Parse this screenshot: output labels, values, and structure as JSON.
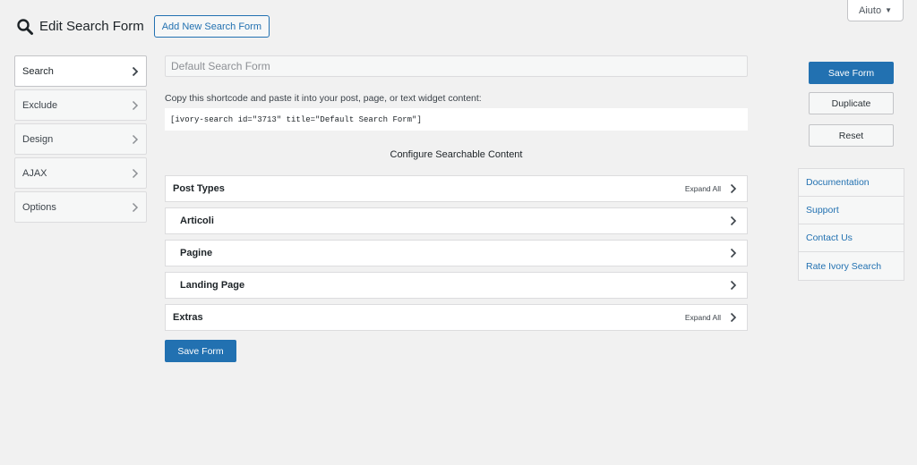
{
  "help": {
    "label": "Aiuto"
  },
  "header": {
    "title": "Edit Search Form",
    "add_new_label": "Add New Search Form"
  },
  "side_tabs": [
    {
      "label": "Search",
      "active": true
    },
    {
      "label": "Exclude"
    },
    {
      "label": "Design"
    },
    {
      "label": "AJAX"
    },
    {
      "label": "Options"
    }
  ],
  "form": {
    "title_placeholder": "Default Search Form",
    "shortcode_desc": "Copy this shortcode and paste it into your post, page, or text widget content:",
    "shortcode": "[ivory-search id=\"3713\" title=\"Default Search Form\"]",
    "config_heading": "Configure Searchable Content",
    "panels": [
      {
        "label": "Post Types",
        "expand_all": "Expand All"
      },
      {
        "label": "Articoli"
      },
      {
        "label": "Pagine"
      },
      {
        "label": "Landing Page"
      },
      {
        "label": "Extras",
        "expand_all": "Expand All"
      }
    ],
    "save_label": "Save Form"
  },
  "actions": {
    "save_label": "Save Form",
    "duplicate_label": "Duplicate",
    "reset_label": "Reset"
  },
  "links": [
    {
      "label": "Documentation"
    },
    {
      "label": "Support"
    },
    {
      "label": "Contact Us"
    },
    {
      "label": "Rate Ivory Search"
    }
  ],
  "colors": {
    "accent": "#2271b1",
    "background": "#f1f1f1"
  }
}
